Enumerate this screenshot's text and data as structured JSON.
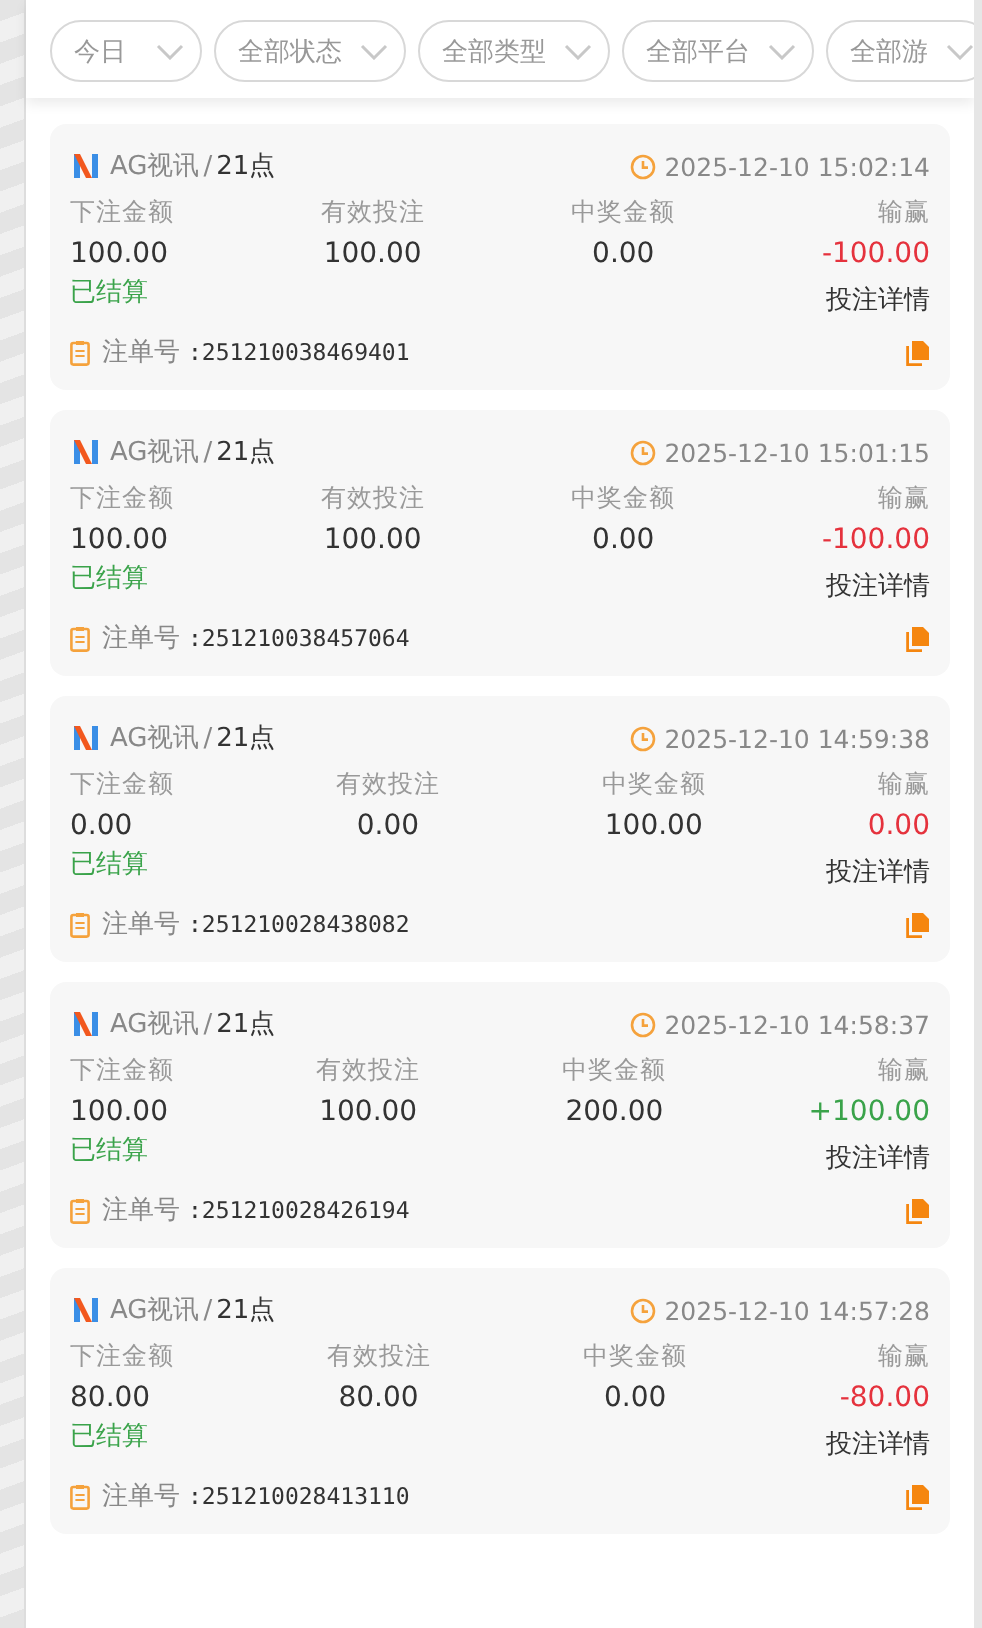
{
  "filters": [
    {
      "label": "今日"
    },
    {
      "label": "全部状态"
    },
    {
      "label": "全部类型"
    },
    {
      "label": "全部平台"
    },
    {
      "label": "全部游"
    }
  ],
  "bets": [
    {
      "platform": "AG视讯",
      "separator": "/",
      "game": "21点",
      "time": "2025-12-10 15:02:14",
      "columns": [
        {
          "label": "下注金额",
          "value": "100.00"
        },
        {
          "label": "有效投注",
          "value": "100.00"
        },
        {
          "label": "中奖金额",
          "value": "0.00"
        },
        {
          "label": "输赢",
          "value": "-100.00",
          "color": "#e5323d"
        }
      ],
      "status": "已结算",
      "detail": "投注详情",
      "order_label": "注单号",
      "order_no": ":251210038469401"
    },
    {
      "platform": "AG视讯",
      "separator": "/",
      "game": "21点",
      "time": "2025-12-10 15:01:15",
      "columns": [
        {
          "label": "下注金额",
          "value": "100.00"
        },
        {
          "label": "有效投注",
          "value": "100.00"
        },
        {
          "label": "中奖金额",
          "value": "0.00"
        },
        {
          "label": "输赢",
          "value": "-100.00",
          "color": "#e5323d"
        }
      ],
      "status": "已结算",
      "detail": "投注详情",
      "order_label": "注单号",
      "order_no": ":251210038457064"
    },
    {
      "platform": "AG视讯",
      "separator": "/",
      "game": "21点",
      "time": "2025-12-10 14:59:38",
      "columns": [
        {
          "label": "下注金额",
          "value": "0.00"
        },
        {
          "label": "有效投注",
          "value": "0.00"
        },
        {
          "label": "中奖金额",
          "value": "100.00"
        },
        {
          "label": "输赢",
          "value": "0.00",
          "color": "#e5323d"
        }
      ],
      "status": "已结算",
      "detail": "投注详情",
      "order_label": "注单号",
      "order_no": ":251210028438082"
    },
    {
      "platform": "AG视讯",
      "separator": "/",
      "game": "21点",
      "time": "2025-12-10 14:58:37",
      "columns": [
        {
          "label": "下注金额",
          "value": "100.00"
        },
        {
          "label": "有效投注",
          "value": "100.00"
        },
        {
          "label": "中奖金额",
          "value": "200.00"
        },
        {
          "label": "输赢",
          "value": "+100.00",
          "color": "#3aa34a"
        }
      ],
      "status": "已结算",
      "detail": "投注详情",
      "order_label": "注单号",
      "order_no": ":251210028426194"
    },
    {
      "platform": "AG视讯",
      "separator": "/",
      "game": "21点",
      "time": "2025-12-10 14:57:28",
      "columns": [
        {
          "label": "下注金额",
          "value": "80.00"
        },
        {
          "label": "有效投注",
          "value": "80.00"
        },
        {
          "label": "中奖金额",
          "value": "0.00"
        },
        {
          "label": "输赢",
          "value": "-80.00",
          "color": "#e5323d"
        }
      ],
      "status": "已结算",
      "detail": "投注详情",
      "order_label": "注单号",
      "order_no": ":251210028413110"
    }
  ]
}
